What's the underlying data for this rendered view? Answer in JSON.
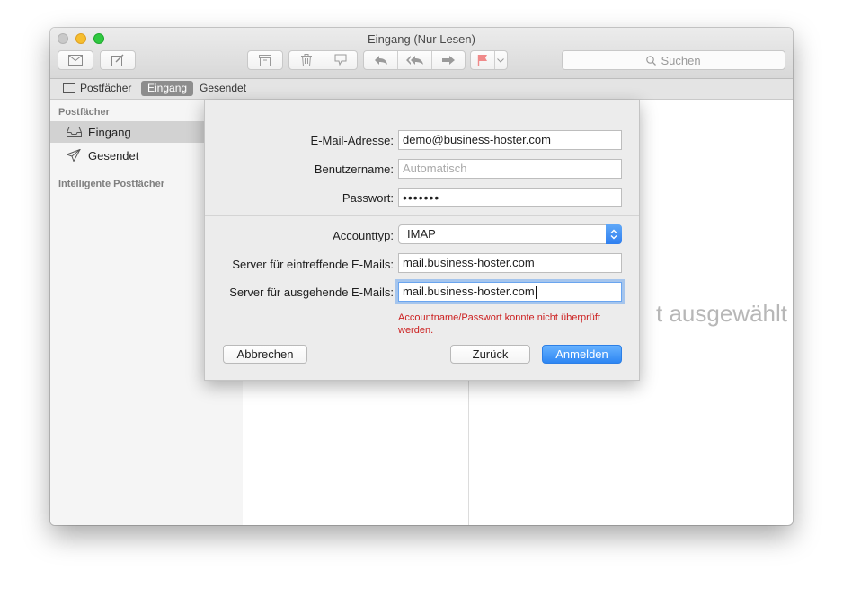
{
  "window": {
    "title": "Eingang (Nur Lesen)"
  },
  "toolbar": {
    "icons": [
      "envelope-icon",
      "compose-icon",
      "archive-icon",
      "trash-icon",
      "junk-icon",
      "reply-icon",
      "reply-all-icon",
      "forward-icon",
      "flag-icon",
      "chevron-down-icon"
    ],
    "search_placeholder": "Suchen"
  },
  "favorites": {
    "mailboxes": "Postfächer",
    "inbox": "Eingang",
    "sent": "Gesendet"
  },
  "sidebar": {
    "section_mailboxes": "Postfächer",
    "items": [
      {
        "label": "Eingang",
        "icon": "inbox-tray-icon"
      },
      {
        "label": "Gesendet",
        "icon": "paper-plane-icon"
      }
    ],
    "section_smart": "Intelligente Postfächer"
  },
  "viewer": {
    "no_selection": "t ausgewählt"
  },
  "dialog": {
    "email_label": "E-Mail-Adresse:",
    "email_value": "demo@business-hoster.com",
    "username_label": "Benutzername:",
    "username_placeholder": "Automatisch",
    "password_label": "Passwort:",
    "password_value": "•••••••",
    "account_type_label": "Accounttyp:",
    "account_type_value": "IMAP",
    "incoming_label": "Server für eintreffende E-Mails:",
    "incoming_value": "mail.business-hoster.com",
    "outgoing_label": "Server für ausgehende E-Mails:",
    "outgoing_value": "mail.business-hoster.com",
    "error_line1": "Accountname/Passwort konnte nicht überprüft",
    "error_line2": "werden.",
    "cancel": "Abbrechen",
    "back": "Zurück",
    "signin": "Anmelden"
  },
  "colors": {
    "accent": "#2d86f3",
    "error": "#cc1f1f",
    "flag": "#f08a8a"
  }
}
